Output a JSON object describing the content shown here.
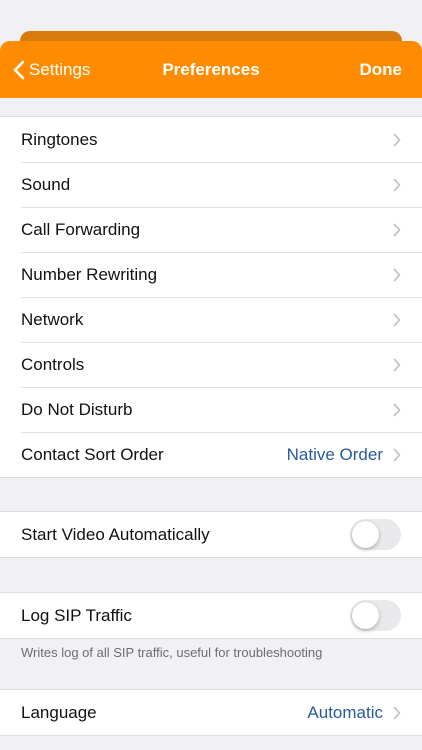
{
  "nav": {
    "back_label": "Settings",
    "title": "Preferences",
    "done_label": "Done",
    "accent_color": "#ff8c00"
  },
  "preferences": [
    {
      "label": "Ringtones",
      "value": ""
    },
    {
      "label": "Sound",
      "value": ""
    },
    {
      "label": "Call Forwarding",
      "value": ""
    },
    {
      "label": "Number Rewriting",
      "value": ""
    },
    {
      "label": "Network",
      "value": ""
    },
    {
      "label": "Controls",
      "value": ""
    },
    {
      "label": "Do Not Disturb",
      "value": ""
    },
    {
      "label": "Contact Sort Order",
      "value": "Native Order"
    }
  ],
  "video": {
    "label": "Start Video Automatically",
    "enabled": false
  },
  "sip": {
    "label": "Log SIP Traffic",
    "enabled": false,
    "footnote": "Writes log of all SIP traffic, useful for troubleshooting"
  },
  "language": {
    "label": "Language",
    "value": "Automatic"
  },
  "icons": {
    "back": "chevron-left-icon",
    "disclosure": "chevron-right-icon"
  }
}
